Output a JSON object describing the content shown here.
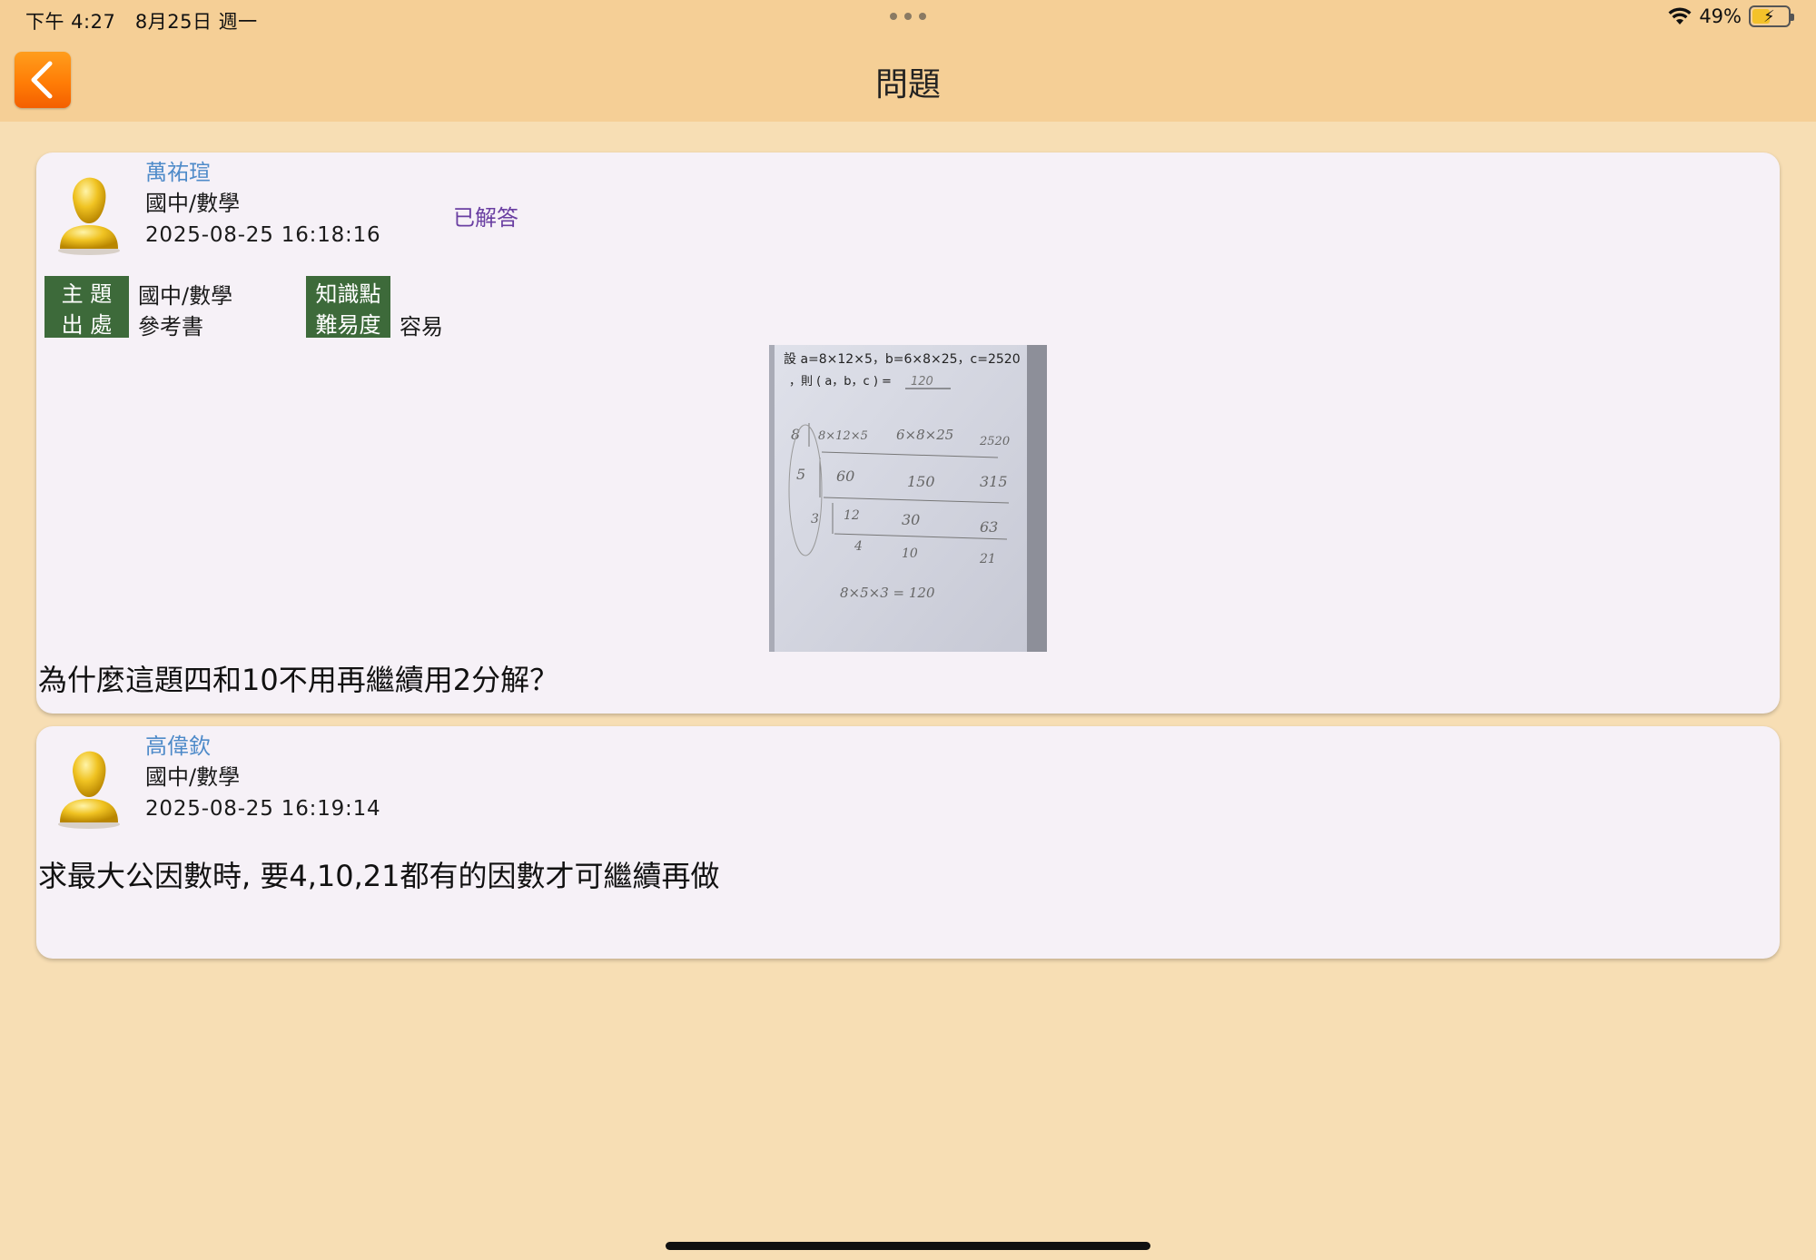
{
  "status_bar": {
    "time": "下午 4:27",
    "date": "8月25日 週一",
    "battery": "49%",
    "battery_level": 0.49
  },
  "header": {
    "title": "問題",
    "back_icon": "chevron-left-icon"
  },
  "colors": {
    "page_bg": "#f7deb4",
    "header_bg": "#f5cf96",
    "card_bg": "#f6f1f7",
    "name": "#4f8bc9",
    "answered": "#6a3fa2",
    "meta_label_bg": "#3d6a3a",
    "back_button": "#ff8a10"
  },
  "posts": [
    {
      "author": "萬祐瑄",
      "subject": "國中/數學",
      "datetime": "2025-08-25 16:18:16",
      "status": "已解答",
      "meta": {
        "topic_label": "主 題",
        "topic_value": "國中/數學",
        "source_label": "出 處",
        "source_value": "參考書",
        "knowledge_label": "知識點",
        "knowledge_value": "",
        "difficulty_label": "難易度",
        "difficulty_value": "容易"
      },
      "image": {
        "line1": "設 a=8×12×5，b=6×8×25，c=2520",
        "line2": "，則 ( a，b，c ) =",
        "answer": "120",
        "rows": [
          [
            "8",
            "8×12×5",
            "6×8×25",
            "2520"
          ],
          [
            "5",
            "60",
            "150",
            "315"
          ],
          [
            "3",
            "12",
            "30",
            "63"
          ],
          [
            "",
            "4",
            "10",
            "21"
          ]
        ],
        "result": "8×5×3 = 120"
      },
      "text": "為什麼這題四和10不用再繼續用2分解？"
    },
    {
      "author": "高偉欽",
      "subject": "國中/數學",
      "datetime": "2025-08-25 16:19:14",
      "text": "求最大公因數時, 要4,10,21都有的因數才可繼續再做"
    }
  ]
}
